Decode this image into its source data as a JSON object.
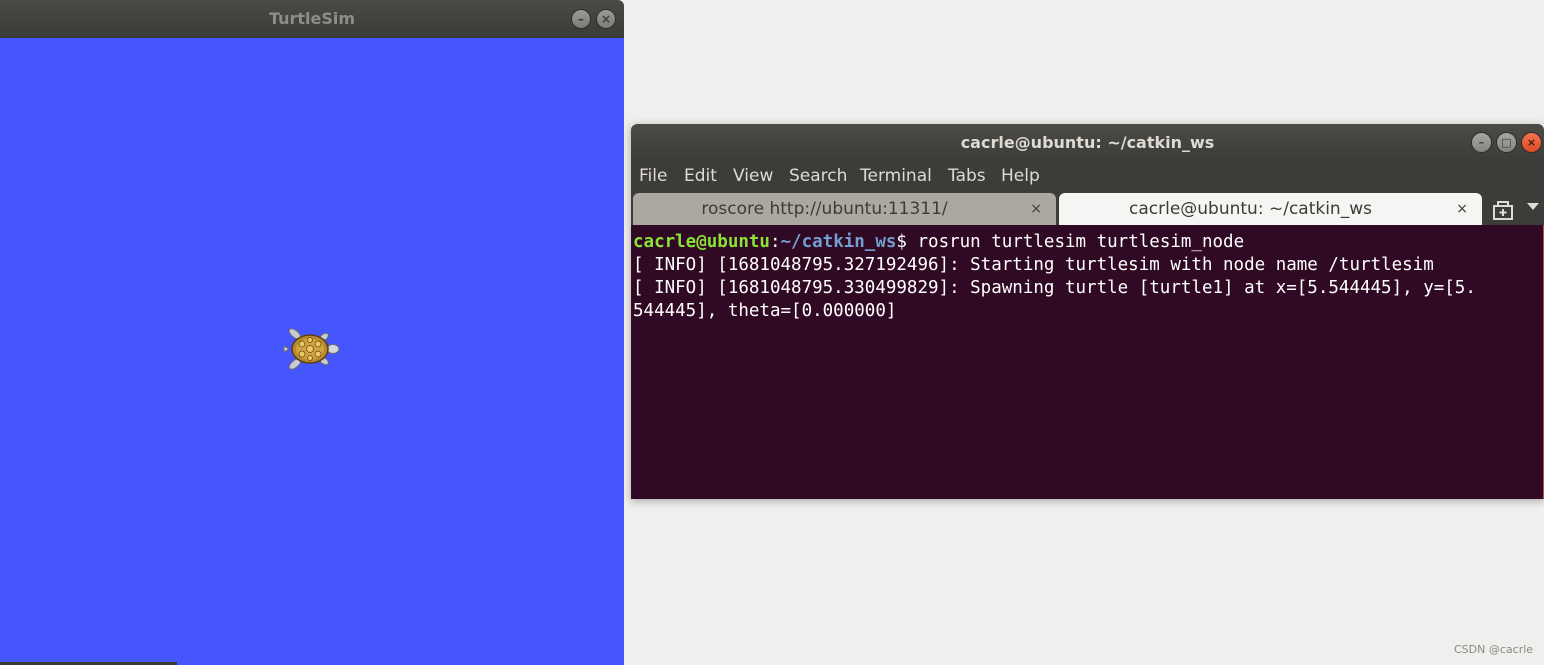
{
  "turtlesim": {
    "title": "TurtleSim",
    "background_color": "#4556ff",
    "buttons": {
      "minimize": "–",
      "close": "×"
    }
  },
  "terminal": {
    "title": "cacrle@ubuntu: ~/catkin_ws",
    "menu": [
      "File",
      "Edit",
      "View",
      "Search",
      "Terminal",
      "Tabs",
      "Help"
    ],
    "tabs": [
      {
        "label": "roscore http://ubuntu:11311/",
        "active": false
      },
      {
        "label": "cacrle@ubuntu: ~/catkin_ws",
        "active": true
      }
    ],
    "tab_close": "×",
    "window_buttons": {
      "minimize": "–",
      "maximize": "□",
      "close": "×"
    },
    "prompt": {
      "user": "cacrle@ubuntu",
      "sep": ":",
      "path": "~/catkin_ws",
      "symbol": "$ "
    },
    "command": "rosrun turtlesim turtlesim_node",
    "output": [
      "[ INFO] [1681048795.327192496]: Starting turtlesim with node name /turtlesim",
      "[ INFO] [1681048795.330499829]: Spawning turtle [turtle1] at x=[5.544445], y=[5.",
      "544445], theta=[0.000000]"
    ],
    "background_color": "#300a24"
  },
  "watermark": "CSDN @cacrle"
}
